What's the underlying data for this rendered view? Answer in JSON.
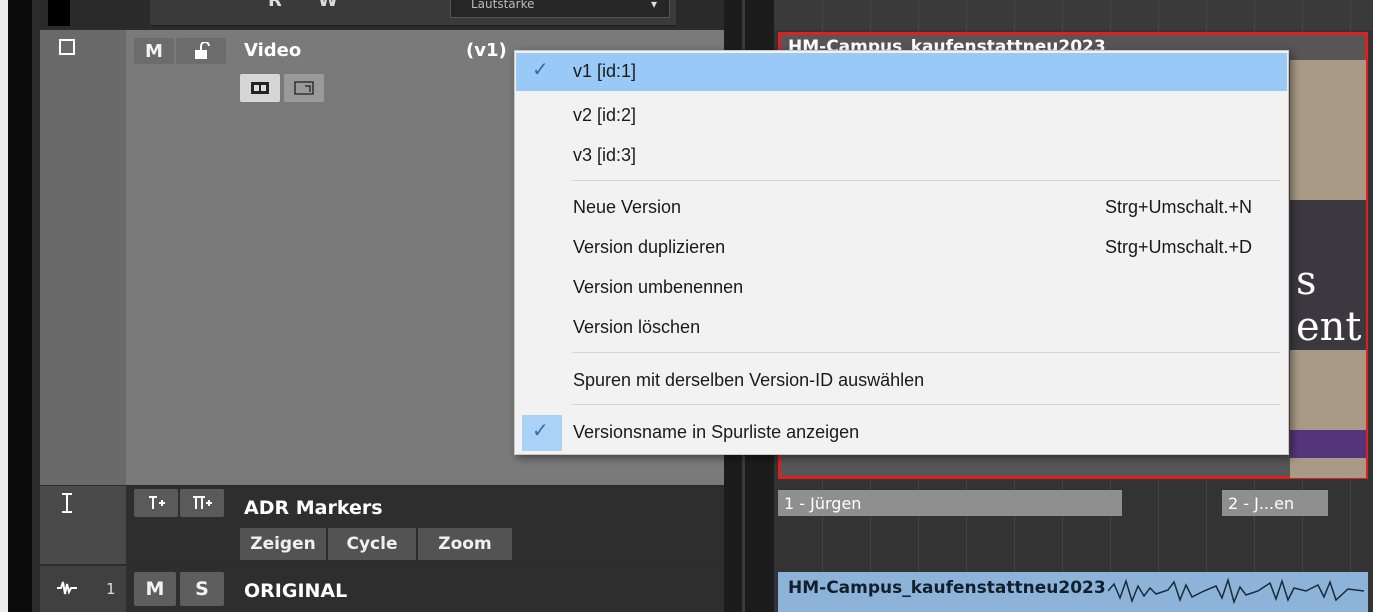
{
  "automation": {
    "r": "R",
    "w": "W",
    "dropdown_value": "Lautstärke"
  },
  "video_track": {
    "mute": "M",
    "name": "Video",
    "version": "(v1)"
  },
  "adr_track": {
    "name": "ADR Markers",
    "buttons": [
      "Zeigen",
      "Cycle",
      "Zoom"
    ]
  },
  "original_track": {
    "number": "1",
    "mute": "M",
    "solo": "S",
    "name": "ORIGINAL"
  },
  "arrange": {
    "video_event_title": "HM-Campus_kaufenstattneu2023",
    "video_overlay": [
      "s",
      "ent"
    ],
    "markers": [
      "1 - Jürgen",
      "2 - J...en"
    ],
    "audio_event_title": "HM-Campus_kaufenstattneu2023"
  },
  "menu": {
    "versions": [
      {
        "label": "v1 [id:1]",
        "checked": true
      },
      {
        "label": "v2 [id:2]"
      },
      {
        "label": "v3 [id:3]"
      }
    ],
    "actions": [
      {
        "label": "Neue Version",
        "shortcut": "Strg+Umschalt.+N"
      },
      {
        "label": "Version duplizieren",
        "shortcut": "Strg+Umschalt.+D"
      },
      {
        "label": "Version umbenennen"
      },
      {
        "label": "Version löschen"
      }
    ],
    "select_same_id": "Spuren mit derselben Version-ID auswählen",
    "show_name": "Versionsname in Spurliste anzeigen",
    "checkmark": "✓"
  },
  "colors": {
    "selection": "#99c9f6",
    "video_event_border": "#e02020",
    "audio_event": "#8db4d8"
  }
}
